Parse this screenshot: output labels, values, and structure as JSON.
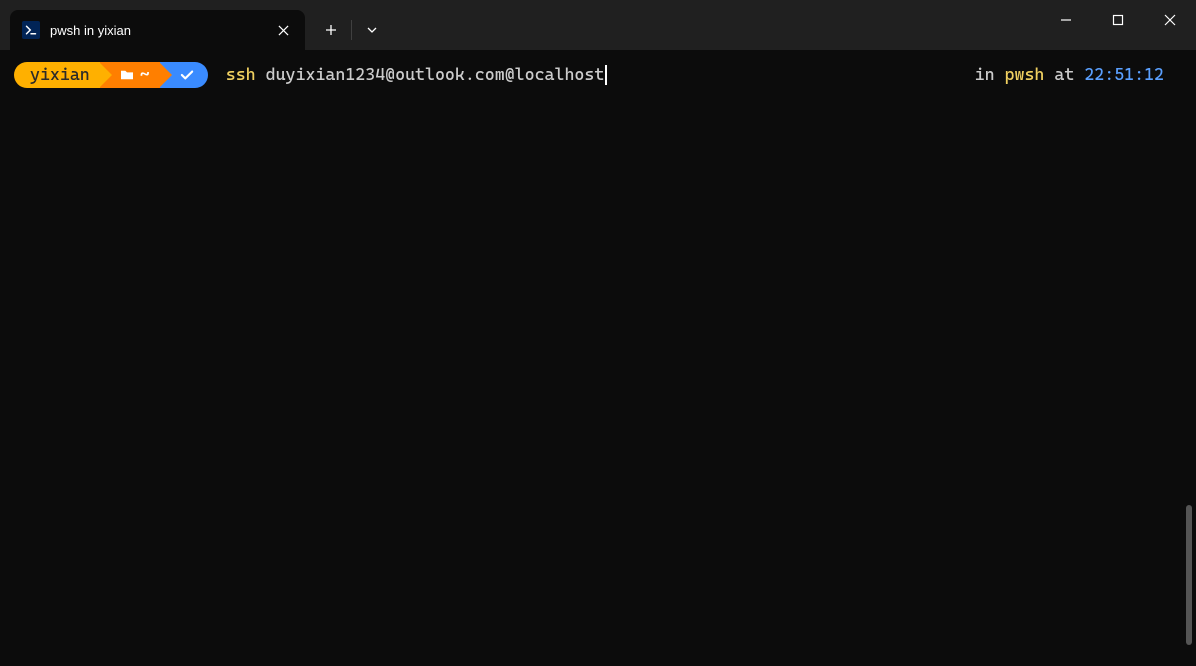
{
  "tab": {
    "title": "pwsh in yixian"
  },
  "prompt": {
    "user": "yixian",
    "path": "~"
  },
  "command": {
    "cmd": "ssh",
    "arg": "duyixian1234@outlook.com@localhost"
  },
  "status": {
    "in": "in",
    "shell": "pwsh",
    "at": "at",
    "time": "22:51:12"
  }
}
